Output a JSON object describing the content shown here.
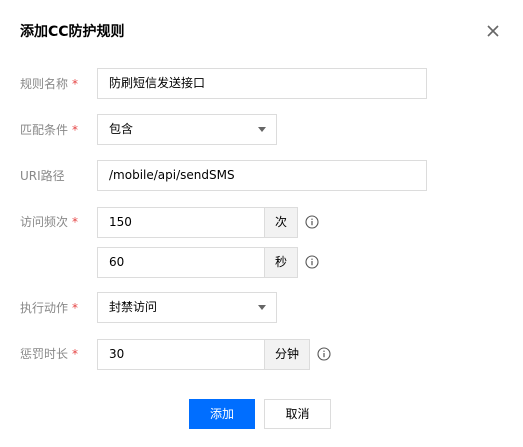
{
  "dialog": {
    "title": "添加CC防护规则"
  },
  "form": {
    "rule_name": {
      "label": "规则名称",
      "required": "*",
      "value": "防刷短信发送接口"
    },
    "match_condition": {
      "label": "匹配条件",
      "required": "*",
      "selected": "包含"
    },
    "uri_path": {
      "label": "URI路径",
      "value": "/mobile/api/sendSMS"
    },
    "access_frequency": {
      "label": "访问频次",
      "required": "*",
      "count_value": "150",
      "count_unit": "次",
      "seconds_value": "60",
      "seconds_unit": "秒"
    },
    "action": {
      "label": "执行动作",
      "required": "*",
      "selected": "封禁访问"
    },
    "penalty_duration": {
      "label": "惩罚时长",
      "required": "*",
      "value": "30",
      "unit": "分钟"
    }
  },
  "footer": {
    "add_label": "添加",
    "cancel_label": "取消"
  },
  "colors": {
    "primary": "#006eff",
    "required": "#e54545",
    "label": "#888888",
    "border": "#dcdcdc"
  },
  "icons": [
    "close-icon",
    "chevron-down-icon",
    "info-icon"
  ]
}
